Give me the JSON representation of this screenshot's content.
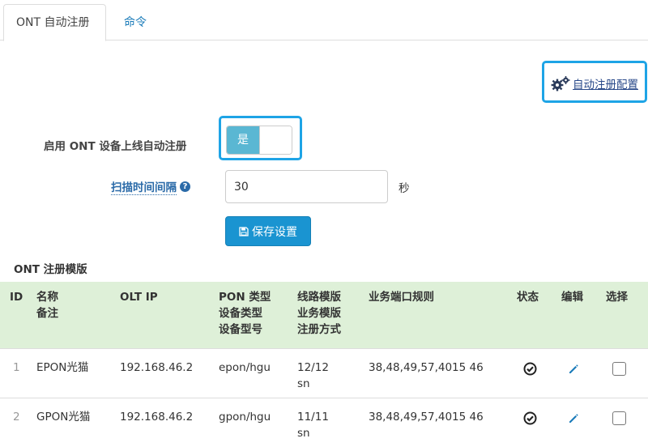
{
  "tabs": [
    {
      "label": "ONT 自动注册",
      "active": true
    },
    {
      "label": "命令",
      "active": false
    }
  ],
  "config_link": {
    "label": "自动注册配置",
    "icon": "gears-icon"
  },
  "form": {
    "enable_label": "启用 ONT 设备上线自动注册",
    "enable_toggle": {
      "on_label": "是",
      "state": "on"
    },
    "interval_label": "扫描时间间隔",
    "interval_value": "30",
    "interval_unit": "秒",
    "save_label": "保存设置"
  },
  "section_title": "ONT 注册模版",
  "table": {
    "headers": {
      "id": "ID",
      "name": [
        "名称",
        "备注"
      ],
      "olt_ip": "OLT IP",
      "pon": [
        "PON 类型",
        "设备类型",
        "设备型号"
      ],
      "line": [
        "线路模版",
        "业务模版",
        "注册方式"
      ],
      "ports": "业务端口规则",
      "status": "状态",
      "edit": "编辑",
      "select": "选择"
    },
    "rows": [
      {
        "id": "1",
        "name": "EPON光猫",
        "olt_ip": "192.168.46.2",
        "pon": "epon/hgu",
        "line": "12/12",
        "reg": "sn",
        "ports": "38,48,49,57,4015 46"
      },
      {
        "id": "2",
        "name": "GPON光猫",
        "olt_ip": "192.168.46.2",
        "pon": "gpon/hgu",
        "line": "11/11",
        "reg": "sn",
        "ports": "38,48,49,57,4015 46"
      }
    ]
  },
  "colors": {
    "accent": "#1a94d1",
    "highlight": "#1ea4e6",
    "table_header": "#def0d8",
    "toggle_on": "#5ab7d3"
  }
}
